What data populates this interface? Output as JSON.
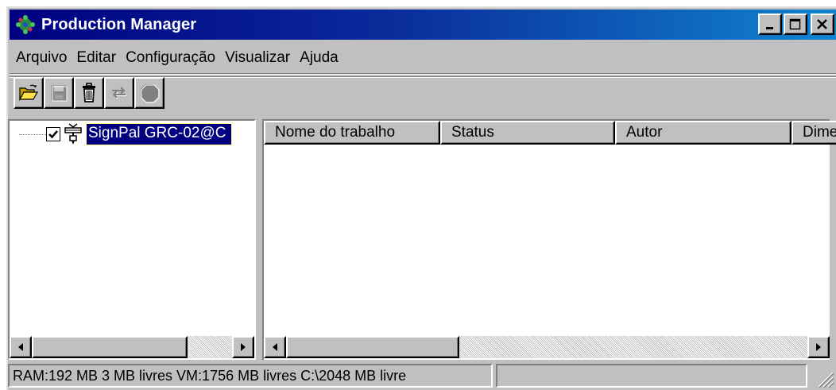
{
  "window": {
    "title": "Production Manager",
    "controls": [
      "minimize",
      "maximize",
      "close"
    ]
  },
  "menu": {
    "items": [
      "Arquivo",
      "Editar",
      "Configuração",
      "Visualizar",
      "Ajuda"
    ]
  },
  "toolbar": {
    "buttons": [
      {
        "icon": "open-folder-icon",
        "enabled": true
      },
      {
        "icon": "save-icon",
        "enabled": false
      },
      {
        "icon": "trash-icon",
        "enabled": true
      },
      {
        "icon": "transfer-icon",
        "enabled": false
      },
      {
        "icon": "stop-icon",
        "enabled": false
      }
    ]
  },
  "tree": {
    "items": [
      {
        "label": "SignPal GRC-02@C",
        "checked": true,
        "icon": "printer-icon",
        "selected": true
      }
    ]
  },
  "list": {
    "columns": [
      "Nome do trabalho",
      "Status",
      "Autor",
      "Dime"
    ],
    "rows": []
  },
  "statusbar": {
    "text": "RAM:192 MB 3 MB livres VM:1756 MB livres C:\\2048 MB livre"
  },
  "colors": {
    "titlebar_start": "#000080",
    "titlebar_end": "#1084d0",
    "selection": "#000080",
    "face": "#c0c0c0"
  }
}
